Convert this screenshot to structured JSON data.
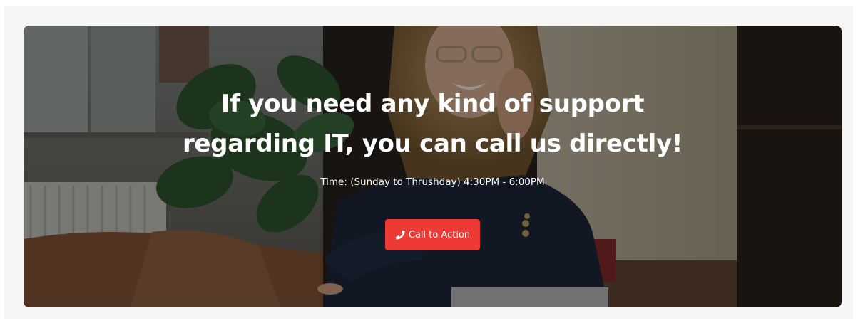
{
  "banner": {
    "headline_line1": "If you need any kind of support",
    "headline_line2": "regarding IT, you can call us directly!",
    "hours": "Time: (Sunday to Thrushday) 4:30PM - 6:00PM",
    "cta_label": "Call to Action",
    "cta_icon": "phone-icon",
    "background_image": "woman-on-phone-photo"
  },
  "colors": {
    "accent": "#ee3a35",
    "text": "#ffffff",
    "section_background": "#f6f6f6"
  }
}
